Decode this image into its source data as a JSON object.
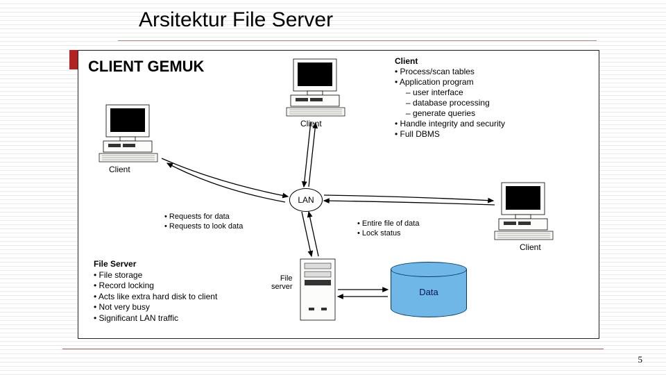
{
  "title": "Arsitektur File Server",
  "subtitle": "CLIENT GEMUK",
  "page_number": "5",
  "labels": {
    "client_left": "Client",
    "client_top": "Client",
    "client_right": "Client",
    "lan": "LAN",
    "file_server_node": "File\nserver",
    "data_cylinder": "Data"
  },
  "client_section": {
    "heading": "Client",
    "items": [
      "Process/scan tables",
      "Application program"
    ],
    "sub_items": [
      "user interface",
      "database processing",
      "generate queries"
    ],
    "items_after": [
      "Handle integrity and security",
      "Full DBMS"
    ]
  },
  "requests_up": [
    "Requests for data",
    "Requests to look data"
  ],
  "responses_down": [
    "Entire file of data",
    "Lock status"
  ],
  "fileserver_section": {
    "heading": "File Server",
    "items": [
      "File storage",
      "Record locking",
      "Acts like extra hard disk to client",
      "Not very busy",
      "Significant LAN traffic"
    ]
  }
}
